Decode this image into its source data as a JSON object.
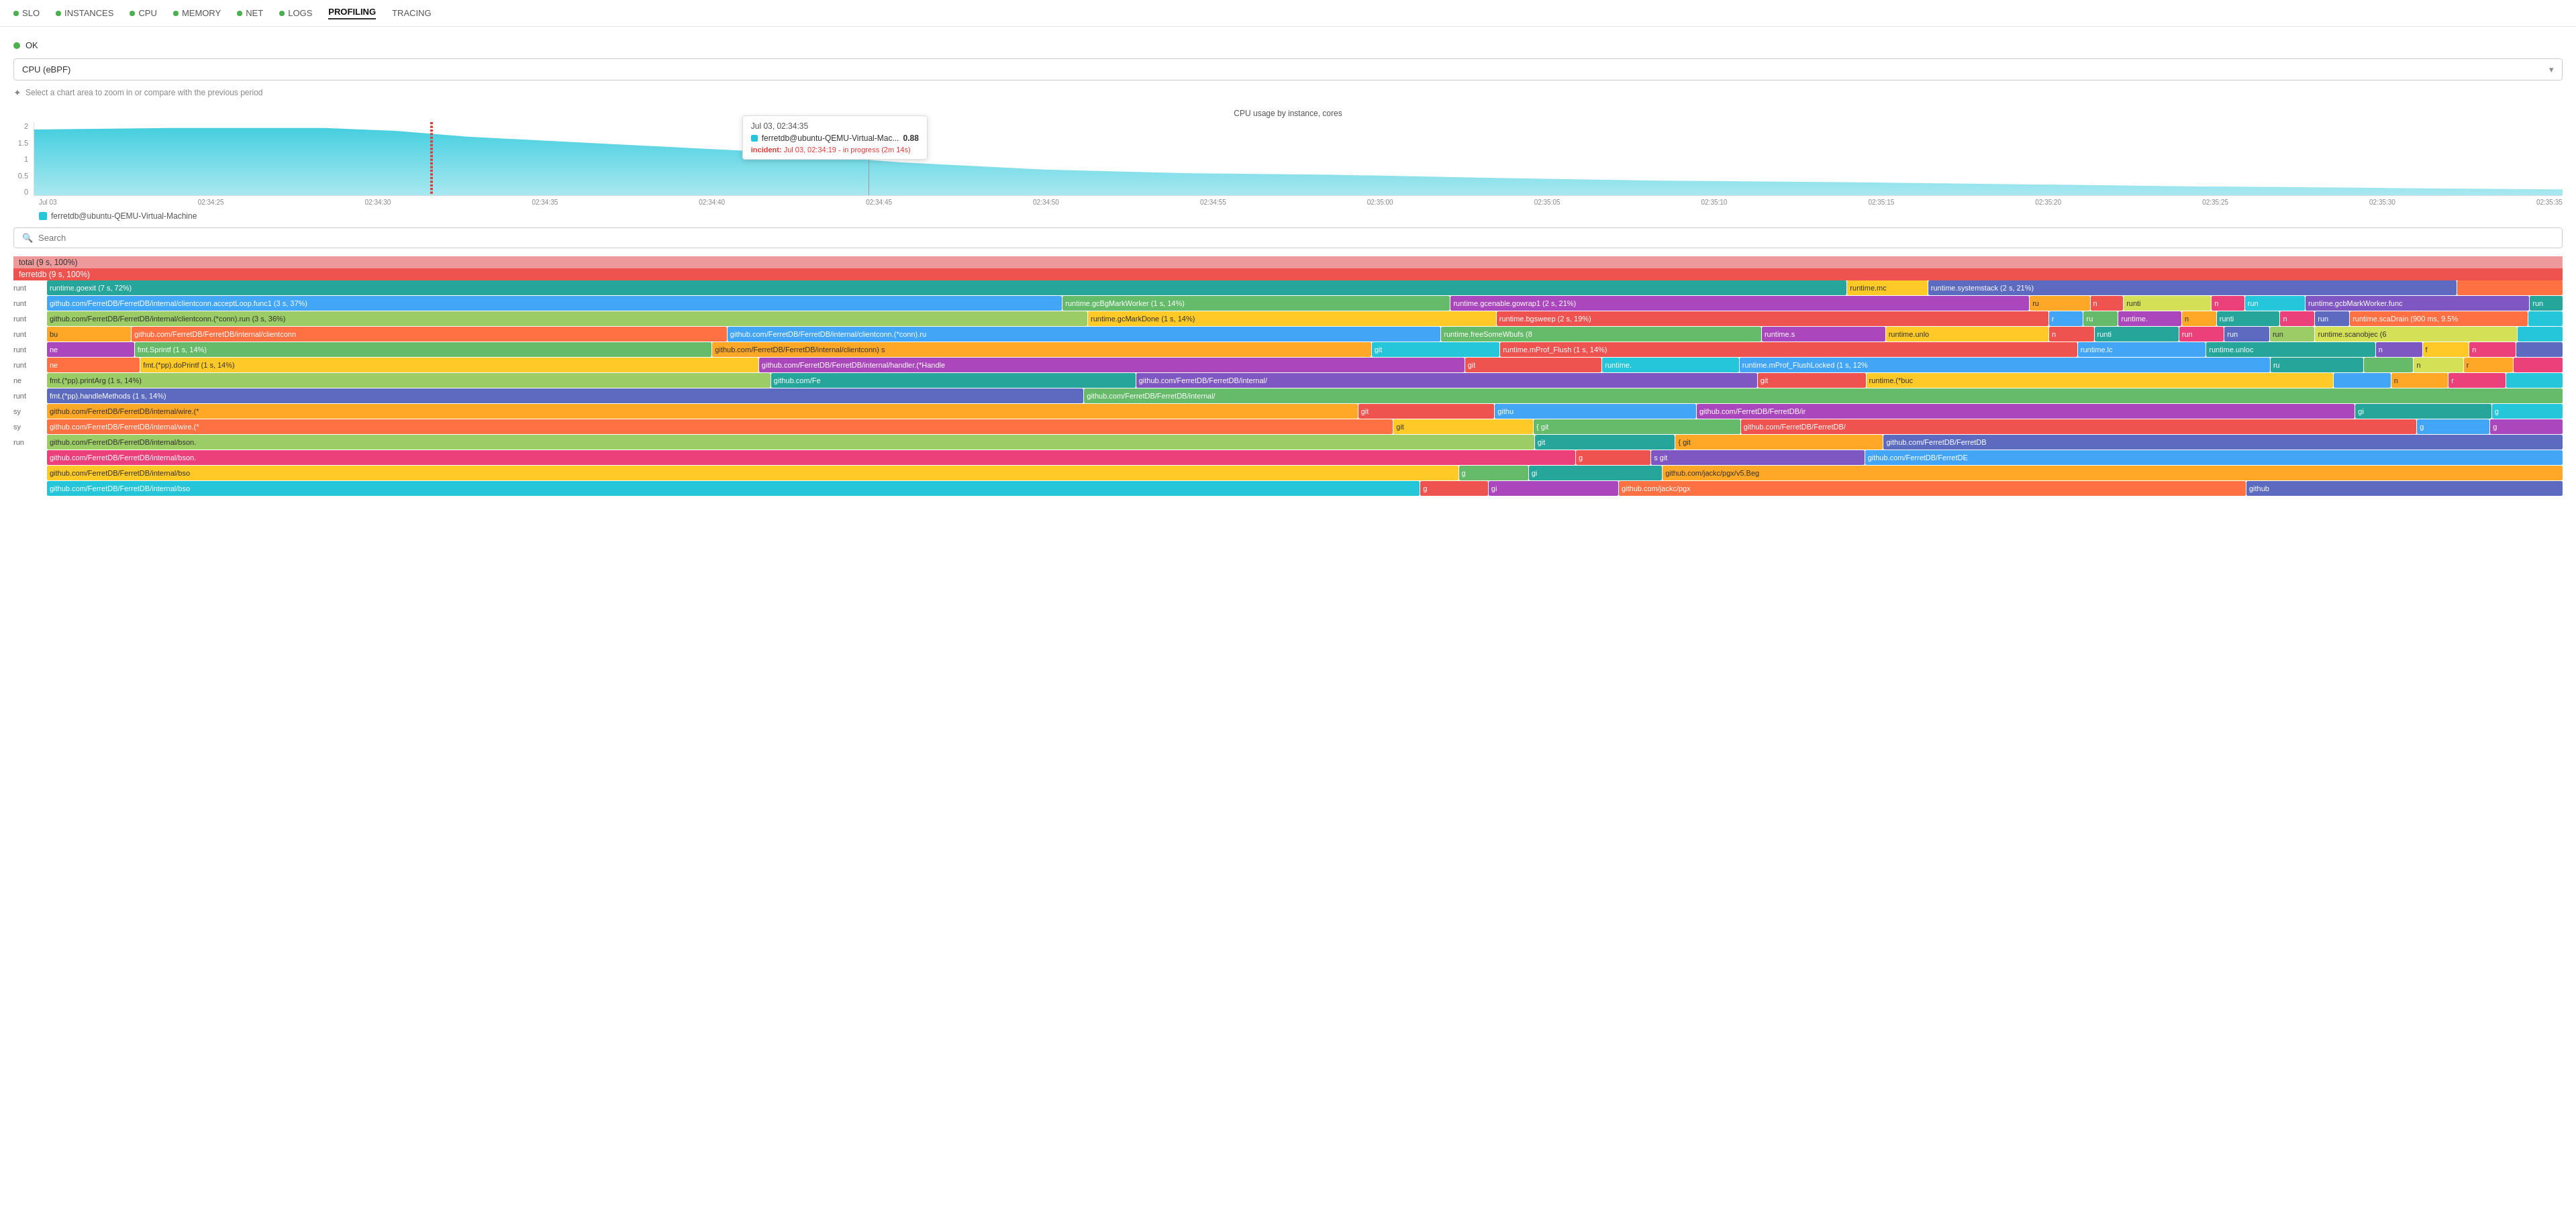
{
  "nav": {
    "items": [
      {
        "label": "SLO",
        "dot": true,
        "active": false
      },
      {
        "label": "INSTANCES",
        "dot": true,
        "active": false
      },
      {
        "label": "CPU",
        "dot": true,
        "active": false
      },
      {
        "label": "MEMORY",
        "dot": true,
        "active": false
      },
      {
        "label": "NET",
        "dot": true,
        "active": false
      },
      {
        "label": "LOGS",
        "dot": true,
        "active": false
      },
      {
        "label": "PROFILING",
        "dot": false,
        "active": true
      },
      {
        "label": "TRACING",
        "dot": false,
        "active": false
      }
    ]
  },
  "status": {
    "label": "OK"
  },
  "dropdown": {
    "value": "CPU (eBPF)"
  },
  "hint": {
    "text": "Select a chart area to zoom in or compare with the previous period"
  },
  "chart": {
    "title": "CPU usage by instance, cores",
    "yaxis": [
      "2",
      "1.5",
      "1",
      "0.5",
      "0"
    ],
    "xaxis": [
      "Jul 03",
      "02:34:25",
      "02:34:30",
      "02:34:35",
      "02:34:40",
      "02:34:45",
      "02:34:50",
      "02:34:55",
      "02:35:00",
      "02:35:05",
      "02:35:10",
      "02:35:15",
      "02:35:20",
      "02:35:25",
      "02:35:30",
      "02:35:35"
    ],
    "tooltip": {
      "date": "Jul 03, 02:34:35",
      "instance": "ferretdb@ubuntu-QEMU-Virtual-Mac...",
      "value": "0.88",
      "incident_label": "incident:",
      "incident_text": "Jul 03, 02:34:19 - in progress (2m 14s)"
    },
    "legend": "ferretdb@ubuntu-QEMU-Virtual-Machine"
  },
  "search": {
    "placeholder": "Search"
  },
  "flamegraph": {
    "total_row": "total (9 s, 100%)",
    "db_row": "ferretdb (9 s, 100%)",
    "rows": [
      {
        "prefix": "runt",
        "blocks": [
          {
            "text": "runtime.goexit (7 s, 72%)",
            "color": "teal",
            "width": 72
          },
          {
            "text": "runtime.mc",
            "color": "amber",
            "width": 3
          },
          {
            "text": "runtime.systemstack (2 s, 21%)",
            "color": "indigo",
            "width": 21
          },
          {
            "text": "",
            "color": "deep-orange",
            "width": 4
          }
        ]
      },
      {
        "prefix": "runt",
        "blocks": [
          {
            "text": "github.com/FerretDB/FerretDB/internal/clientconn.acceptLoop.func1 (3 s, 37%)",
            "color": "blue",
            "width": 37
          },
          {
            "text": "runtime.gcBgMarkWorker (1 s, 14%)",
            "color": "green",
            "width": 14
          },
          {
            "text": "runtime.gcenable.gowrap1 (2 s, 21%)",
            "color": "purple",
            "width": 21
          },
          {
            "text": "ru",
            "color": "orange",
            "width": 2
          },
          {
            "text": "n",
            "color": "red",
            "width": 1
          },
          {
            "text": "runti",
            "color": "lime",
            "width": 3
          },
          {
            "text": "n",
            "color": "pink",
            "width": 1
          },
          {
            "text": "run",
            "color": "light-blue",
            "width": 2
          },
          {
            "text": "runtime.gcbMarkWorker.func",
            "color": "deep-purple",
            "width": 8
          },
          {
            "text": "run",
            "color": "teal",
            "width": 1
          }
        ]
      },
      {
        "prefix": "runt",
        "blocks": [
          {
            "text": "github.com/FerretDB/FerretDB/internal/clientconn.(*conn).run (3 s, 36%)",
            "color": "light-green",
            "width": 36
          },
          {
            "text": "runtime.gcMarkDone (1 s, 14%)",
            "color": "amber",
            "width": 14
          },
          {
            "text": "runtime.bgsweep (2 s, 19%)",
            "color": "red",
            "width": 19
          },
          {
            "text": "r",
            "color": "blue",
            "width": 1
          },
          {
            "text": "ru",
            "color": "green",
            "width": 1
          },
          {
            "text": "runtime.",
            "color": "purple",
            "width": 2
          },
          {
            "text": "n",
            "color": "orange",
            "width": 1
          },
          {
            "text": "runti",
            "color": "teal",
            "width": 2
          },
          {
            "text": "n",
            "color": "pink",
            "width": 1
          },
          {
            "text": "run",
            "color": "indigo",
            "width": 1
          },
          {
            "text": "runtime.scaDrain (900 ms, 9.5%",
            "color": "deep-orange",
            "width": 6
          },
          {
            "text": "",
            "color": "light-blue",
            "width": 1
          }
        ]
      },
      {
        "prefix": "runt",
        "blocks": [
          {
            "text": "bu",
            "color": "orange",
            "width": 2
          },
          {
            "text": "github.com/FerretDB/FerretDB/internal/clientconn",
            "color": "deep-orange",
            "width": 15
          },
          {
            "text": "github.com/FerretDB/FerretDB/internal/clientconn.(*conn).ru",
            "color": "blue",
            "width": 18
          },
          {
            "text": "runtime.freeSomeWbufs (8",
            "color": "green",
            "width": 8
          },
          {
            "text": "runtime.s",
            "color": "purple",
            "width": 3
          },
          {
            "text": "runtime.unlo",
            "color": "amber",
            "width": 4
          },
          {
            "text": "n",
            "color": "red",
            "width": 1
          },
          {
            "text": "runti",
            "color": "teal",
            "width": 2
          },
          {
            "text": "run",
            "color": "pink",
            "width": 1
          },
          {
            "text": "run",
            "color": "indigo",
            "width": 1
          },
          {
            "text": "run",
            "color": "light-green",
            "width": 1
          },
          {
            "text": "runtime.scanobjec (6",
            "color": "lime",
            "width": 5
          },
          {
            "text": "",
            "color": "light-blue",
            "width": 1
          }
        ]
      },
      {
        "prefix": "runt",
        "blocks": [
          {
            "text": "ne",
            "color": "purple",
            "width": 2
          },
          {
            "text": "fmt.Sprintf (1 s, 14%)",
            "color": "green",
            "width": 14
          },
          {
            "text": "github.com/FerretDB/FerretDB/internal/clientconn) s",
            "color": "orange",
            "width": 16
          },
          {
            "text": "git",
            "color": "light-blue",
            "width": 3
          },
          {
            "text": "runtime.mProf_Flush (1 s, 14%)",
            "color": "red",
            "width": 14
          },
          {
            "text": "runtime.lc",
            "color": "blue",
            "width": 3
          },
          {
            "text": "runtime.unloc",
            "color": "teal",
            "width": 4
          },
          {
            "text": "n",
            "color": "deep-purple",
            "width": 1
          },
          {
            "text": "f",
            "color": "amber",
            "width": 1
          },
          {
            "text": "n",
            "color": "pink",
            "width": 1
          },
          {
            "text": "",
            "color": "indigo",
            "width": 1
          }
        ]
      },
      {
        "prefix": "runt",
        "blocks": [
          {
            "text": "ne",
            "color": "deep-orange",
            "width": 2
          },
          {
            "text": "fmt.(*pp).doPrintf (1 s, 14%)",
            "color": "amber",
            "width": 14
          },
          {
            "text": "github.com/FerretDB/FerretDB/internal/handler.(*Handle",
            "color": "purple",
            "width": 16
          },
          {
            "text": "git",
            "color": "red",
            "width": 3
          },
          {
            "text": "runtime.",
            "color": "light-blue",
            "width": 3
          },
          {
            "text": "runtime.mProf_FlushLocked (1 s, 12%",
            "color": "blue",
            "width": 12
          },
          {
            "text": "ru",
            "color": "teal",
            "width": 2
          },
          {
            "text": "",
            "color": "green",
            "width": 1
          },
          {
            "text": "n",
            "color": "lime",
            "width": 1
          },
          {
            "text": "r",
            "color": "orange",
            "width": 1
          },
          {
            "text": "",
            "color": "pink",
            "width": 1
          }
        ]
      },
      {
        "prefix": "ne",
        "blocks": [
          {
            "text": "fmt.(*pp).printArg (1 s, 14%)",
            "color": "light-green",
            "width": 14
          },
          {
            "text": "github.com/Fe",
            "color": "teal",
            "width": 7
          },
          {
            "text": "github.com/FerretDB/FerretDB/internal/",
            "color": "deep-purple",
            "width": 12
          },
          {
            "text": "git",
            "color": "red",
            "width": 2
          },
          {
            "text": "runtime.(*buc",
            "color": "amber",
            "width": 9
          },
          {
            "text": "",
            "color": "blue",
            "width": 1
          },
          {
            "text": "n",
            "color": "orange",
            "width": 1
          },
          {
            "text": "r",
            "color": "pink",
            "width": 1
          },
          {
            "text": "",
            "color": "light-blue",
            "width": 1
          }
        ]
      },
      {
        "prefix": "runt",
        "blocks": [
          {
            "text": "fmt.(*pp).handleMethods (1 s, 14%)",
            "color": "indigo",
            "width": 14
          },
          {
            "text": "github.com/FerretDB/FerretDB/internal/",
            "color": "green",
            "width": 20
          }
        ]
      },
      {
        "prefix": "sy",
        "blocks": [
          {
            "text": "github.com/FerretDB/FerretDB/internal/wire.(*",
            "color": "orange",
            "width": 20
          },
          {
            "text": "git",
            "color": "red",
            "width": 2
          },
          {
            "text": "githu",
            "color": "blue",
            "width": 3
          },
          {
            "text": "github.com/FerretDB/FerretDB/ir",
            "color": "purple",
            "width": 10
          },
          {
            "text": "gi",
            "color": "teal",
            "width": 2
          },
          {
            "text": "g",
            "color": "light-blue",
            "width": 1
          }
        ]
      },
      {
        "prefix": "sy",
        "blocks": [
          {
            "text": "github.com/FerretDB/FerretDB/internal/wire.(*",
            "color": "deep-orange",
            "width": 20
          },
          {
            "text": "git",
            "color": "amber",
            "width": 2
          },
          {
            "text": "{ git",
            "color": "green",
            "width": 3
          },
          {
            "text": "github.com/FerretDB/FerretDB/",
            "color": "red",
            "width": 10
          },
          {
            "text": "g",
            "color": "blue",
            "width": 1
          },
          {
            "text": "g",
            "color": "purple",
            "width": 1
          }
        ]
      },
      {
        "prefix": "run",
        "blocks": [
          {
            "text": "github.com/FerretDB/FerretDB/internal/bson.",
            "color": "light-green",
            "width": 22
          },
          {
            "text": "git",
            "color": "teal",
            "width": 2
          },
          {
            "text": "{ git",
            "color": "orange",
            "width": 3
          },
          {
            "text": "github.com/FerretDB/FerretDB",
            "color": "indigo",
            "width": 10
          }
        ]
      },
      {
        "prefix": "",
        "blocks": [
          {
            "text": "github.com/FerretDB/FerretDB/internal/bson.",
            "color": "pink",
            "width": 22
          },
          {
            "text": "g",
            "color": "red",
            "width": 1
          },
          {
            "text": "s git",
            "color": "deep-purple",
            "width": 3
          },
          {
            "text": "github.com/FerretDB/FerretDE",
            "color": "blue",
            "width": 10
          }
        ]
      },
      {
        "prefix": "",
        "blocks": [
          {
            "text": "github.com/FerretDB/FerretDB/internal/bso",
            "color": "amber",
            "width": 22
          },
          {
            "text": "g",
            "color": "green",
            "width": 1
          },
          {
            "text": "gi",
            "color": "teal",
            "width": 2
          },
          {
            "text": "github.com/jackc/pgx/v5.Beg",
            "color": "orange",
            "width": 14
          }
        ]
      },
      {
        "prefix": "",
        "blocks": [
          {
            "text": "github.com/FerretDB/FerretDB/internal/bso",
            "color": "light-blue",
            "width": 22
          },
          {
            "text": "g",
            "color": "red",
            "width": 1
          },
          {
            "text": "gi",
            "color": "purple",
            "width": 2
          },
          {
            "text": "github.com/jackc/pgx",
            "color": "deep-orange",
            "width": 10
          },
          {
            "text": "github",
            "color": "indigo",
            "width": 5
          }
        ]
      }
    ]
  }
}
